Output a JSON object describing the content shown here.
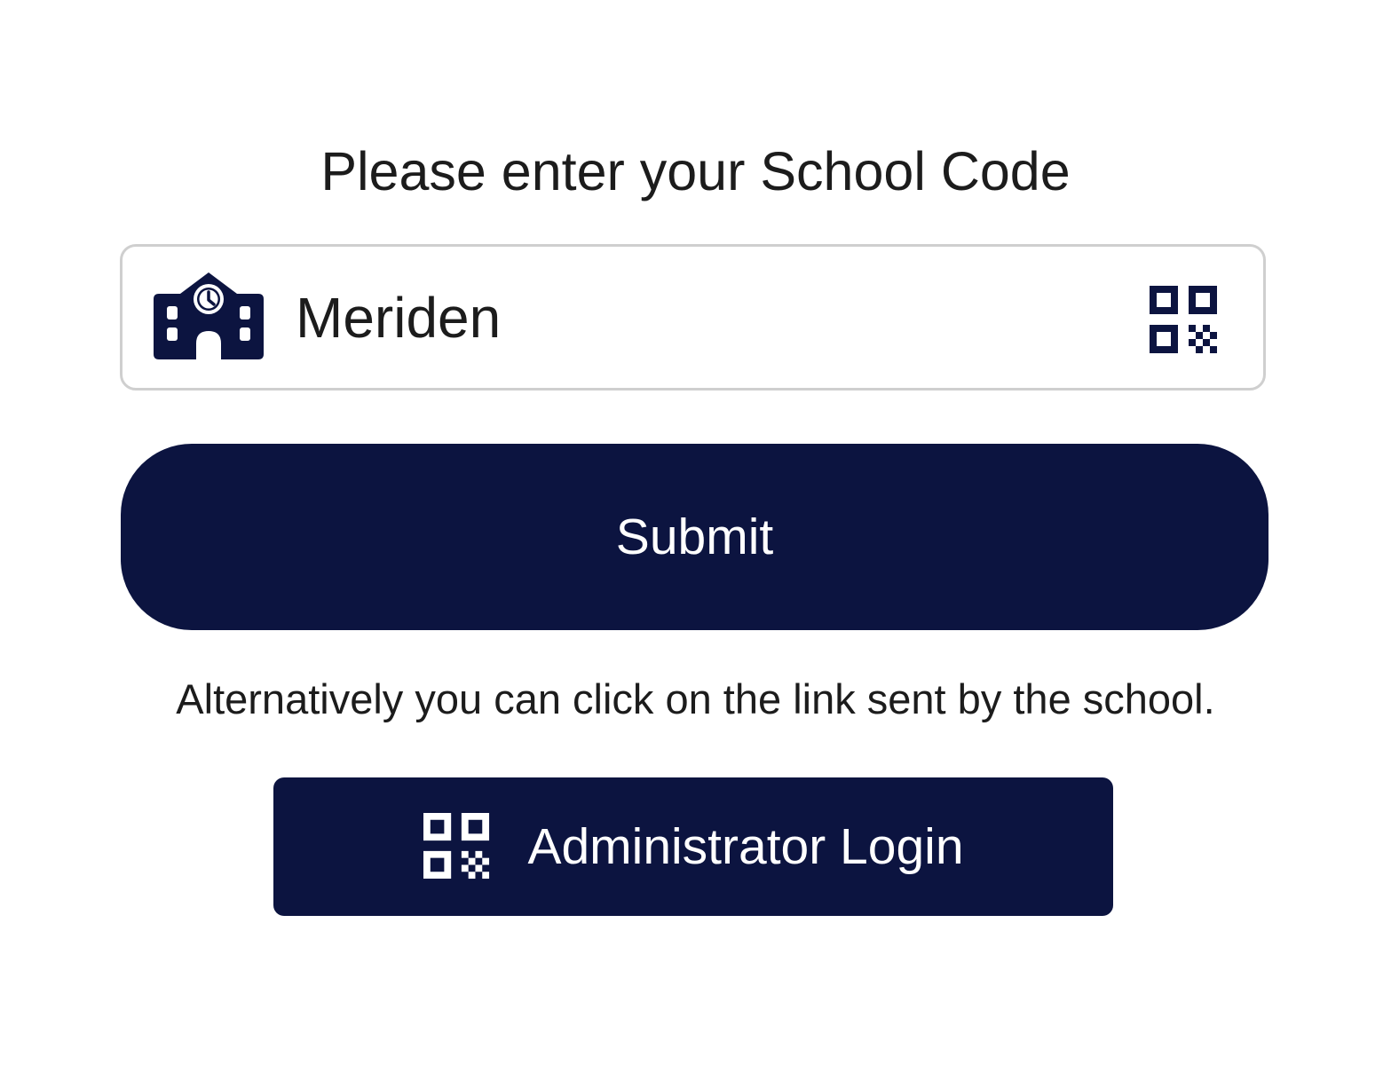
{
  "form": {
    "title": "Please enter your School Code",
    "code_input": {
      "value": "Meriden",
      "leading_icon": "school-building-icon",
      "trailing_icon": "qr-code-icon"
    },
    "submit_label": "Submit",
    "alternative_text": "Alternatively you can click on the link sent by the school.",
    "admin_login": {
      "label": "Administrator Login",
      "icon": "qr-code-icon"
    }
  },
  "colors": {
    "primary": "#0c1440",
    "field_border": "#cfcfcf",
    "text": "#1c1c1c",
    "button_text": "#ffffff",
    "background": "#ffffff"
  }
}
